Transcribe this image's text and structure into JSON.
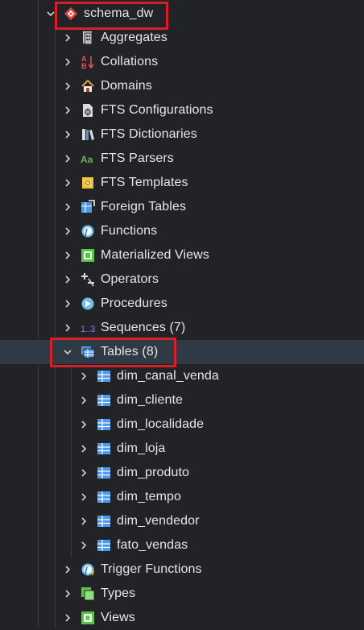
{
  "tree": {
    "schema": {
      "label": "schema_dw",
      "expanded": true
    },
    "schema_items_before": [
      {
        "label": "Aggregates",
        "icon": "aggregates-icon"
      },
      {
        "label": "Collations",
        "icon": "collations-icon"
      },
      {
        "label": "Domains",
        "icon": "domains-icon"
      },
      {
        "label": "FTS Configurations",
        "icon": "fts-configurations-icon"
      },
      {
        "label": "FTS Dictionaries",
        "icon": "fts-dictionaries-icon"
      },
      {
        "label": "FTS Parsers",
        "icon": "fts-parsers-icon"
      },
      {
        "label": "FTS Templates",
        "icon": "fts-templates-icon"
      },
      {
        "label": "Foreign Tables",
        "icon": "foreign-tables-icon"
      },
      {
        "label": "Functions",
        "icon": "functions-icon"
      },
      {
        "label": "Materialized Views",
        "icon": "materialized-views-icon"
      },
      {
        "label": "Operators",
        "icon": "operators-icon"
      },
      {
        "label": "Procedures",
        "icon": "procedures-icon"
      },
      {
        "label": "Sequences (7)",
        "icon": "sequences-icon"
      }
    ],
    "tables": {
      "label": "Tables (8)",
      "expanded": true,
      "items": [
        {
          "label": "dim_canal_venda"
        },
        {
          "label": "dim_cliente"
        },
        {
          "label": "dim_localidade"
        },
        {
          "label": "dim_loja"
        },
        {
          "label": "dim_produto"
        },
        {
          "label": "dim_tempo"
        },
        {
          "label": "dim_vendedor"
        },
        {
          "label": "fato_vendas"
        }
      ]
    },
    "schema_items_after": [
      {
        "label": "Trigger Functions",
        "icon": "trigger-functions-icon"
      },
      {
        "label": "Types",
        "icon": "types-icon"
      },
      {
        "label": "Views",
        "icon": "views-icon"
      }
    ],
    "sequences_icon_text": "1..3",
    "fts_parsers_icon_text": "Aa"
  },
  "colors": {
    "background": "#222326",
    "selected_row": "#2f3a44",
    "highlight_border": "#d71f26",
    "text": "#e6e6e6",
    "table_icon": "#4f9ae8"
  }
}
